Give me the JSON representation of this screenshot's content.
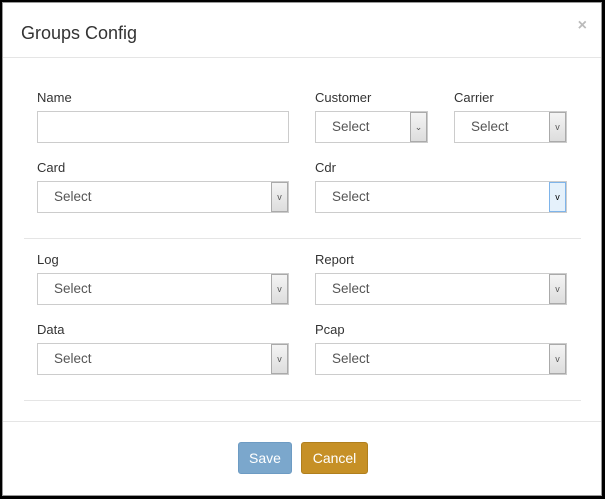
{
  "dialog": {
    "title": "Groups Config",
    "close": "×"
  },
  "fields": {
    "name": {
      "label": "Name",
      "value": "",
      "placeholder": ""
    },
    "customer": {
      "label": "Customer",
      "value": "Select"
    },
    "carrier": {
      "label": "Carrier",
      "value": "Select"
    },
    "card": {
      "label": "Card",
      "value": "Select"
    },
    "cdr": {
      "label": "Cdr",
      "value": "Select"
    },
    "log": {
      "label": "Log",
      "value": "Select"
    },
    "report": {
      "label": "Report",
      "value": "Select"
    },
    "data": {
      "label": "Data",
      "value": "Select"
    },
    "pcap": {
      "label": "Pcap",
      "value": "Select"
    }
  },
  "chevron": "⌄",
  "footer": {
    "save": "Save",
    "cancel": "Cancel"
  },
  "colors": {
    "save": "#7ba7cc",
    "cancel": "#c69026"
  }
}
